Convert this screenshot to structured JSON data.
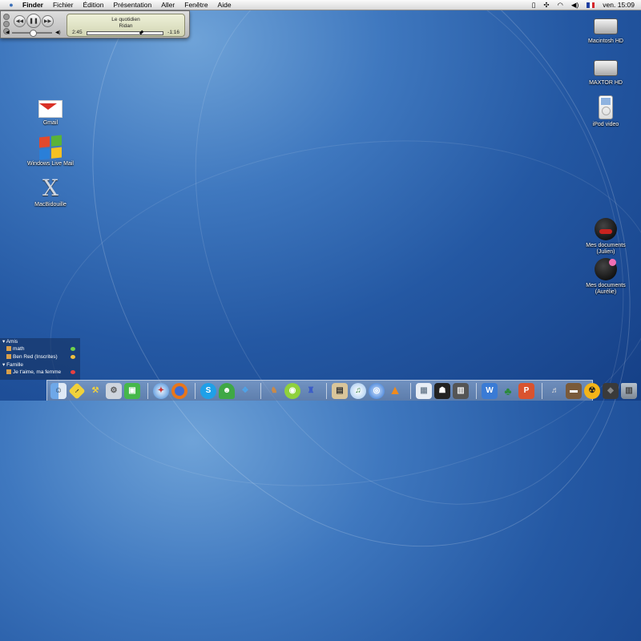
{
  "menubar": {
    "app_name": "Finder",
    "menus": [
      "Fichier",
      "Édition",
      "Présentation",
      "Aller",
      "Fenêtre",
      "Aide"
    ],
    "clock": "ven. 15:09",
    "flag_colors": [
      "#1f3fa0",
      "#ffffff",
      "#d4262b"
    ]
  },
  "itunes": {
    "title": "Le quotidien",
    "artist": "Ridan",
    "elapsed": "2:45",
    "remaining": "-1:16",
    "progress": 0.7,
    "volume": 0.5
  },
  "desktop_left": [
    {
      "label": "Gmail",
      "icon": "gmail-icon"
    },
    {
      "label": "Windows Live Mail",
      "icon": "windows-live-mail-icon"
    },
    {
      "label": "MacBidouille",
      "icon": "macbidouille-x-icon"
    }
  ],
  "desktop_right": [
    {
      "label": "Macintosh HD",
      "icon": "hard-drive-icon"
    },
    {
      "label": "MAXTOR HD",
      "icon": "hard-drive-icon"
    },
    {
      "label": "iPod video",
      "icon": "ipod-icon"
    },
    {
      "label1": "Mes documents",
      "label2": "(Julien)",
      "icon": "bomb-face-icon"
    },
    {
      "label1": "Mes documents",
      "label2": "(Aurélie)",
      "icon": "bomb-flower-icon"
    }
  ],
  "buddy_list": {
    "groups": [
      {
        "name": "Amis",
        "buddies": [
          {
            "name": "math",
            "status_color": "#6fd24a"
          },
          {
            "name": "Ben Red (Inscrites)",
            "status_color": "#f0c040"
          }
        ]
      },
      {
        "name": "Famille",
        "buddies": [
          {
            "name": "Je t'aime, ma femme",
            "status_color": "#e84040"
          }
        ]
      }
    ]
  },
  "dock": {
    "items": [
      "finder",
      "stickies",
      "screwdriver",
      "system-preferences",
      "box",
      "safari",
      "firefox",
      "skype",
      "adium",
      "pawprints",
      "gimp",
      "limewire",
      "chat",
      "preview",
      "itunes",
      "dvd",
      "vlc",
      "paste",
      "theatre",
      "calculator",
      "words",
      "ivy",
      "app",
      "headphones",
      "photo",
      "radioactive",
      "dark-cube",
      "trash"
    ]
  }
}
